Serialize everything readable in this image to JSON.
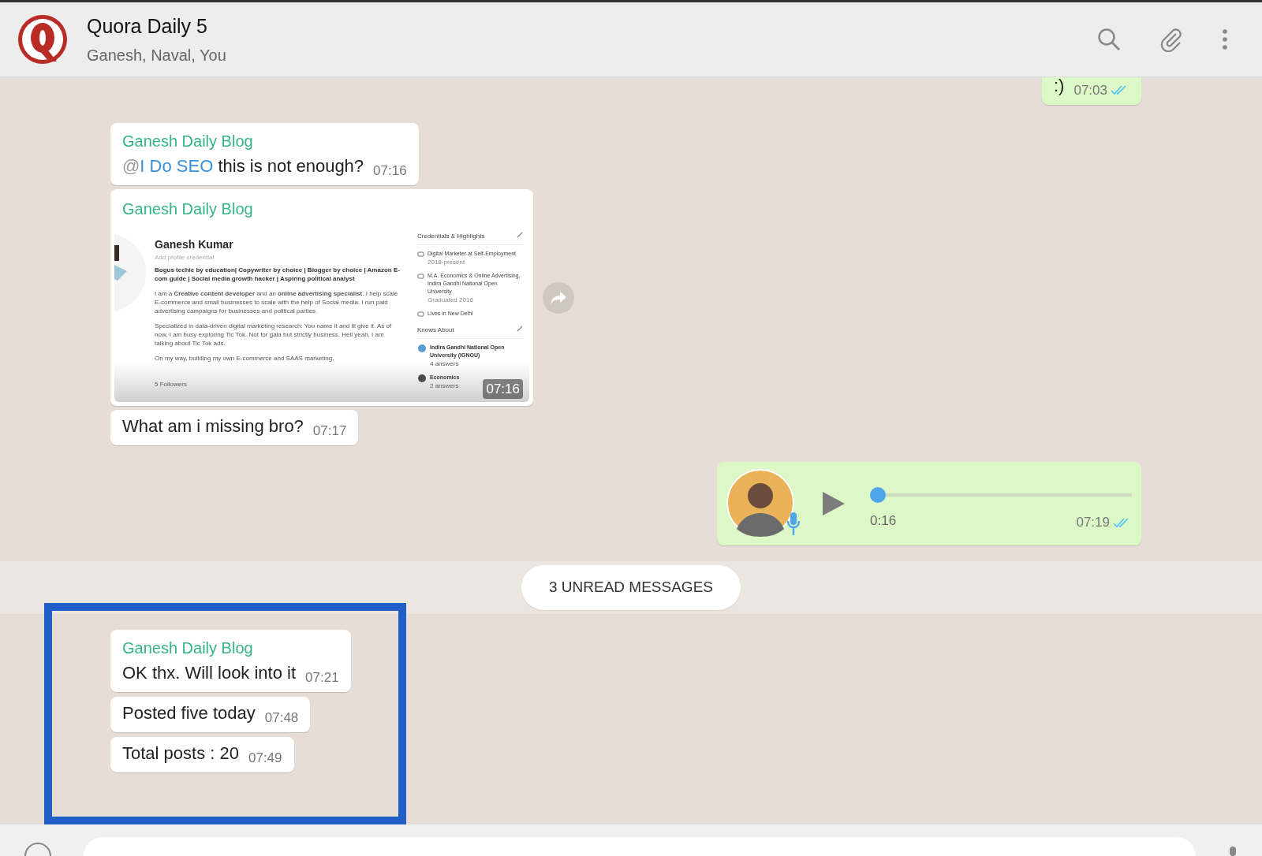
{
  "header": {
    "title": "Quora Daily 5",
    "subtitle": "Ganesh, Naval, You"
  },
  "messages": [
    {
      "kind": "text",
      "outgoing": true,
      "text": ":)",
      "time": "07:03",
      "read": true
    },
    {
      "kind": "text",
      "outgoing": false,
      "sender": "Ganesh Daily Blog",
      "mention": "@",
      "mention_name": "I Do SEO",
      "text": "this is not enough?",
      "time": "07:16"
    },
    {
      "outgoing": false,
      "sender": "Ganesh Daily Blog",
      "time": "07:16",
      "profile": {
        "name": "Ganesh Kumar",
        "credential": "Add profile credential",
        "headline": "Bogus techie by education| Copywriter by choice | Blogger by choice | Amazon E-com guide | Social media growth hacker | Aspiring political analyst",
        "paragraphs": [
          "I am a **Creative content developer** and an **online advertising specialist**. I help scale E-commerce and small businesses to scale with the help of Social media. I run paid advertising campaigns for businesses and political parties.",
          "Specialized in data-driven digital marketing research: You name it and ill give it. As of now, I am busy exploring Tic Tok. Not for gala but strictly business. Hell yeah, I am talking about Tic Tok ads.",
          "On my way, building my own E-commerce and SAAS marketing."
        ],
        "followers": "5 Followers",
        "credentials_title": "Credentials & Highlights",
        "credentials": [
          {
            "text": "Digital Marketer at Self-Employment",
            "sub": "2018-present"
          },
          {
            "text": "M.A. Economics & Online Advertising, Indira Gandhi National Open University",
            "sub": "Graduated 2016"
          },
          {
            "text": "Lives in New Delhi"
          }
        ],
        "knows_title": "Knows About",
        "knows": [
          {
            "text": "Indira Gandhi National Open University (IGNOU)",
            "sub": "4 answers"
          },
          {
            "text": "Economics",
            "sub": "2 answers"
          }
        ]
      }
    },
    {
      "kind": "text",
      "outgoing": false,
      "text": "What am i missing bro?",
      "time": "07:17"
    },
    {
      "kind": "voice",
      "outgoing": true,
      "duration": "0:16",
      "time": "07:19",
      "read": true,
      "level": 0
    },
    {
      "kind": "unread",
      "text": "3 UNREAD MESSAGES"
    },
    {
      "kind": "text",
      "outgoing": false,
      "highlighted": true,
      "sender": "Ganesh Daily Blog",
      "text": "OK thx. Will look into it",
      "time": "07:21"
    },
    {
      "kind": "text",
      "outgoing": false,
      "highlighted": true,
      "text": "Posted five today",
      "time": "07:48"
    },
    {
      "kind": "text",
      "outgoing": false,
      "highlighted": true,
      "text": "Total posts : 20",
      "time": "07:49"
    }
  ]
}
